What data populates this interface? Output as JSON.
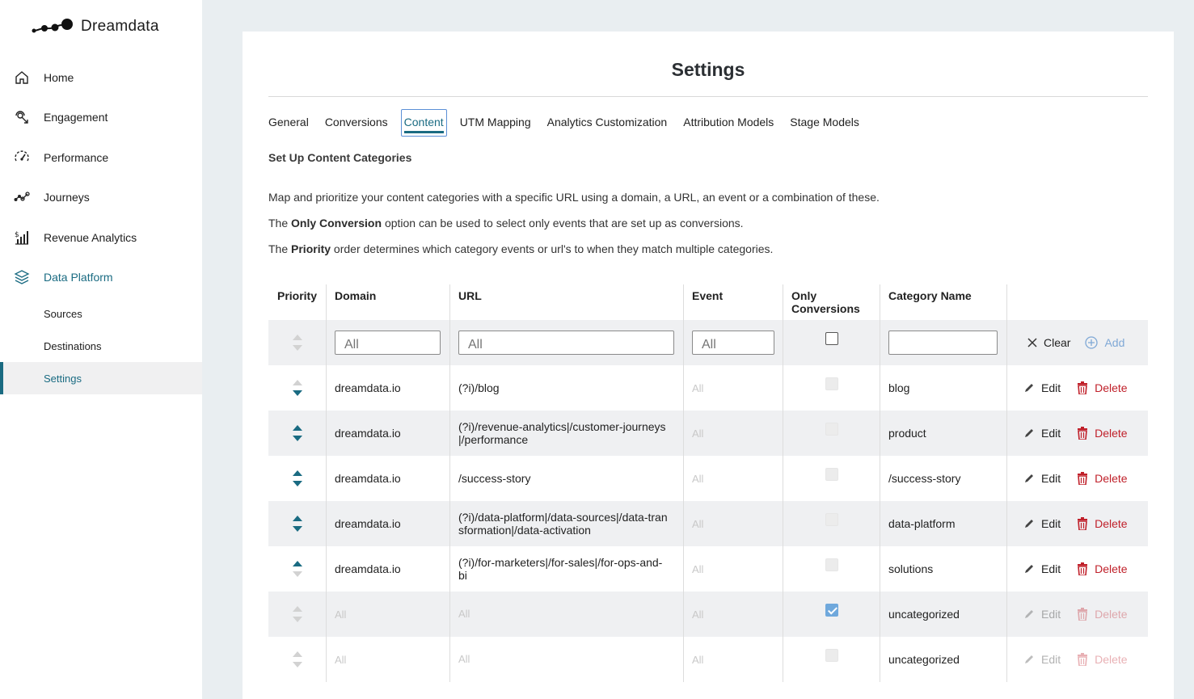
{
  "brand": {
    "name": "Dreamdata"
  },
  "sidebar": {
    "items": [
      {
        "label": "Home",
        "icon": "home-icon"
      },
      {
        "label": "Engagement",
        "icon": "engagement-icon"
      },
      {
        "label": "Performance",
        "icon": "performance-icon"
      },
      {
        "label": "Journeys",
        "icon": "journeys-icon"
      },
      {
        "label": "Revenue Analytics",
        "icon": "revenue-analytics-icon"
      },
      {
        "label": "Data Platform",
        "icon": "layers-icon"
      }
    ],
    "sub_items": [
      {
        "label": "Sources"
      },
      {
        "label": "Destinations"
      },
      {
        "label": "Settings"
      }
    ]
  },
  "page": {
    "title": "Settings",
    "tabs": [
      {
        "label": "General"
      },
      {
        "label": "Conversions"
      },
      {
        "label": "Content"
      },
      {
        "label": "UTM Mapping"
      },
      {
        "label": "Analytics Customization"
      },
      {
        "label": "Attribution Models"
      },
      {
        "label": "Stage Models"
      }
    ],
    "active_tab": "Content",
    "section_title": "Set Up Content Categories",
    "intro": "Map and prioritize your content categories with a specific URL using a domain, a URL, an event or a combination of these.",
    "only_conversion_pre": "The",
    "only_conversion_bold": "Only Conversion",
    "only_conversion_post": "option can be used to select only events that are set up as conversions.",
    "priority_pre": "The",
    "priority_bold": "Priority",
    "priority_post": "order determines which category events or url's to when they match multiple categories."
  },
  "table": {
    "headers": {
      "priority": "Priority",
      "domain": "Domain",
      "url": "URL",
      "event": "Event",
      "only_conversions": "Only Conversions",
      "category": "Category Name"
    },
    "filter": {
      "domain_placeholder": "All",
      "url_placeholder": "All",
      "event_placeholder": "All",
      "category_placeholder": "",
      "clear_label": "Clear",
      "add_label": "Add"
    },
    "rows": [
      {
        "domain": "dreamdata.io",
        "url": "(?i)/blog",
        "event": "All",
        "category": "blog",
        "edit": "Edit",
        "delete": "Delete"
      },
      {
        "domain": "dreamdata.io",
        "url": "(?i)/revenue-analytics|/customer-journeys|/performance",
        "event": "All",
        "category": "product",
        "edit": "Edit",
        "delete": "Delete"
      },
      {
        "domain": "dreamdata.io",
        "url": "/success-story",
        "event": "All",
        "category": "/success-story",
        "edit": "Edit",
        "delete": "Delete"
      },
      {
        "domain": "dreamdata.io",
        "url": "(?i)/data-platform|/data-sources|/data-transformation|/data-activation",
        "event": "All",
        "category": "data-platform",
        "edit": "Edit",
        "delete": "Delete"
      },
      {
        "domain": "dreamdata.io",
        "url": "(?i)/for-marketers|/for-sales|/for-ops-and-bi",
        "event": "All",
        "category": "solutions",
        "edit": "Edit",
        "delete": "Delete"
      },
      {
        "domain": "All",
        "url": "All",
        "event": "All",
        "category": "uncategorized",
        "edit": "Edit",
        "delete": "Delete",
        "only_conversions_checked": true
      },
      {
        "domain": "All",
        "url": "All",
        "event": "All",
        "category": "uncategorized",
        "edit": "Edit",
        "delete": "Delete",
        "only_conversions_checked": false
      }
    ]
  },
  "colors": {
    "accent": "#1a6b82",
    "danger": "#c0202a",
    "background": "#e9eef1"
  }
}
